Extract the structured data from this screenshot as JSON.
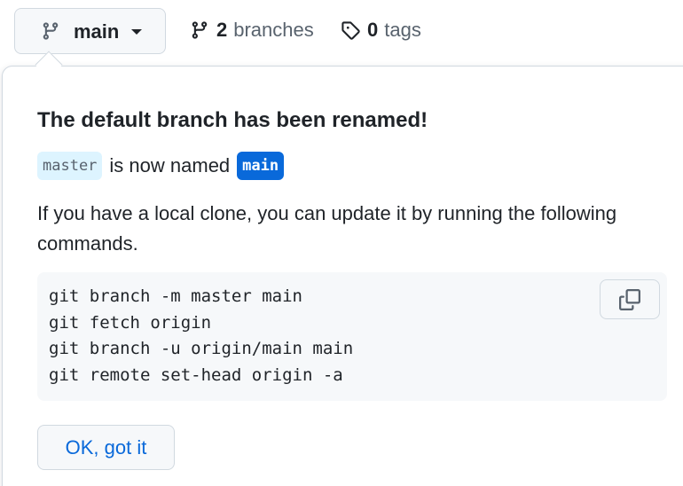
{
  "header": {
    "branch_select": {
      "label": "main",
      "icon": "git-branch-icon"
    },
    "branches": {
      "count": "2",
      "label": "branches",
      "icon": "git-branch-icon"
    },
    "tags": {
      "count": "0",
      "label": "tags",
      "icon": "tag-icon"
    }
  },
  "popover": {
    "title": "The default branch has been renamed!",
    "old_branch": "master",
    "renamed_text": "is now named",
    "new_branch": "main",
    "instructions": "If you have a local clone, you can update it by running the following commands.",
    "commands": [
      "git branch -m master main",
      "git fetch origin",
      "git branch -u origin/main main",
      "git remote set-head origin -a"
    ],
    "copy_icon": "copy-icon",
    "ok_label": "OK, got it"
  },
  "colors": {
    "accent": "#0969da",
    "text": "#1f2328",
    "muted": "#59636e",
    "border": "#d1d9e0",
    "canvas_subtle": "#f6f8fa",
    "old_branch_bg": "#ddf4ff"
  }
}
